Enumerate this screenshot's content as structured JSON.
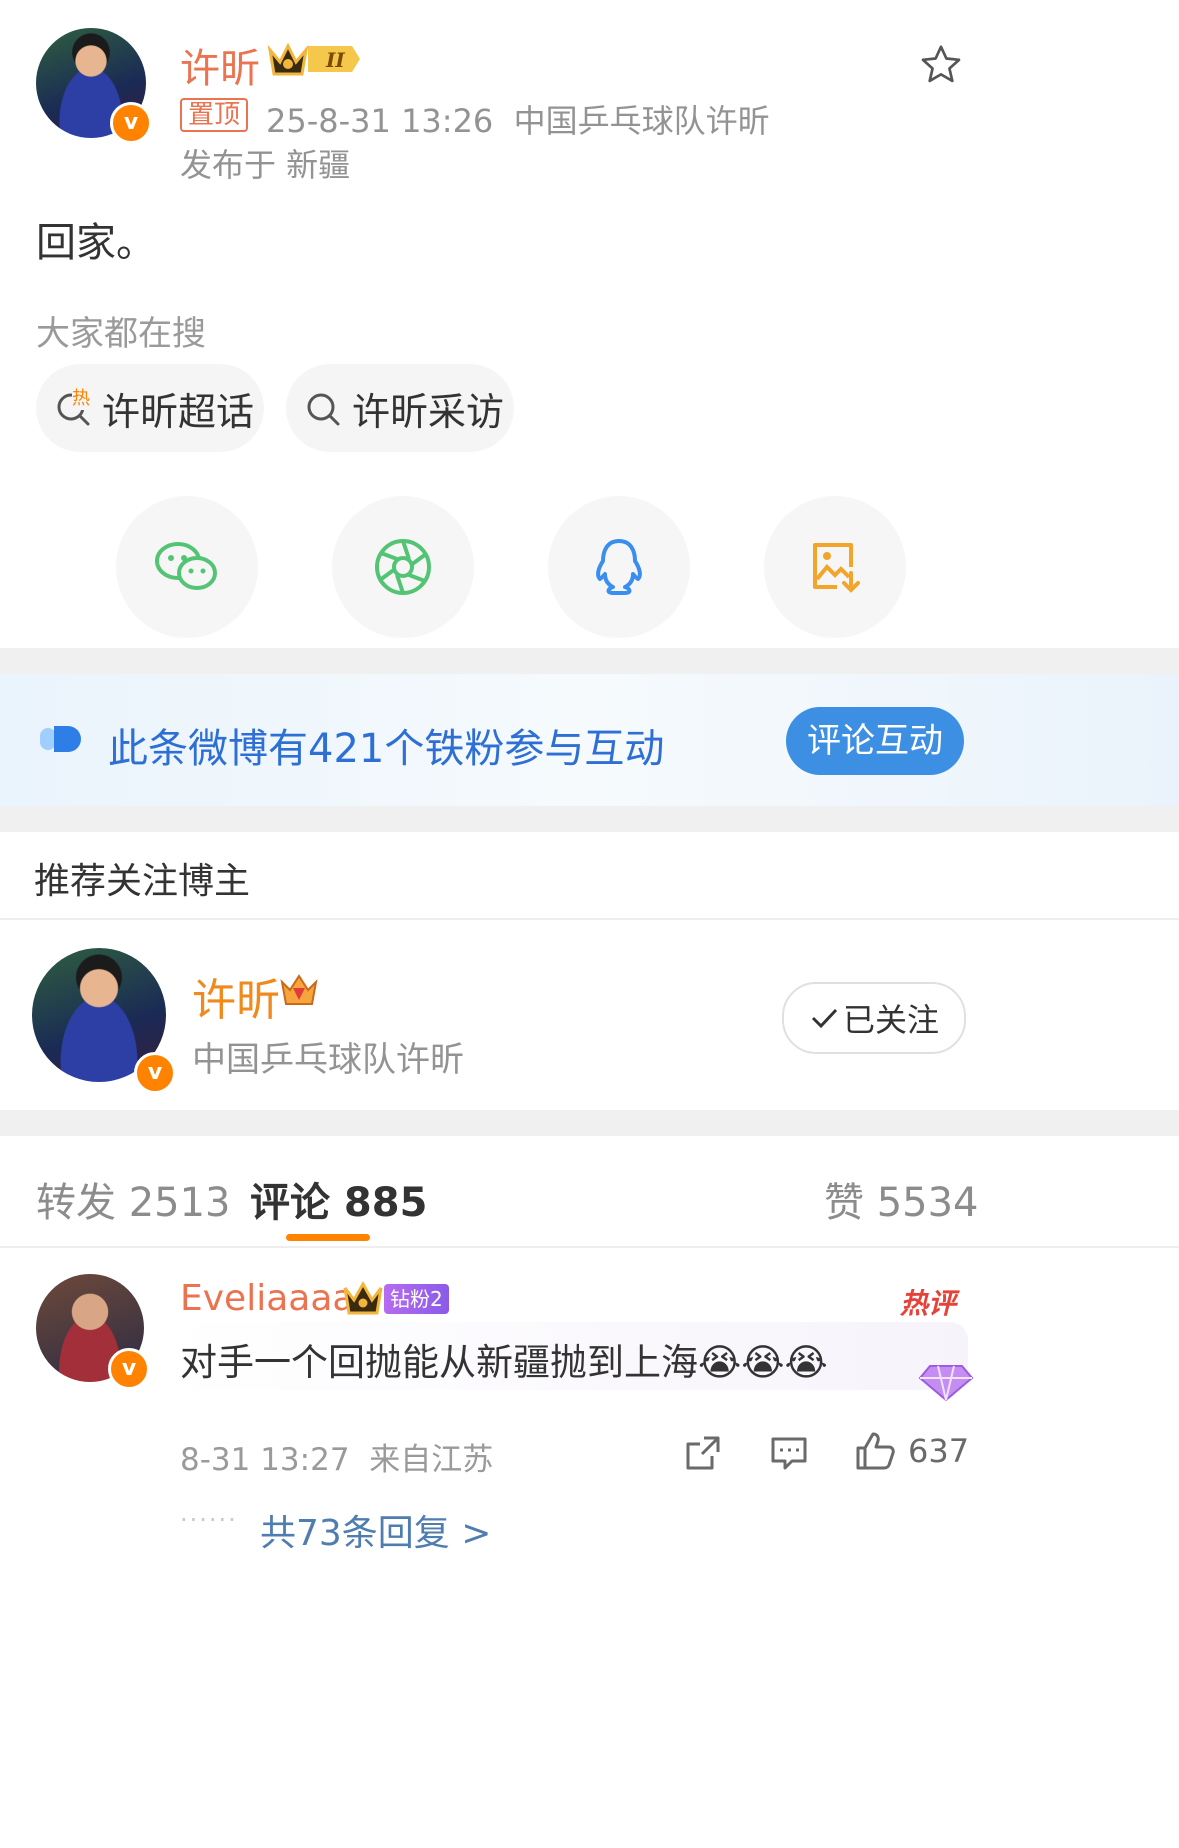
{
  "post": {
    "author": "许昕",
    "level_badge": "II",
    "pinned_label": "置顶",
    "meta": "25-8-31 13:26  中国乒乓球队许昕",
    "location": "发布于 新疆",
    "content": "回家。"
  },
  "search": {
    "title": "大家都在搜",
    "hot_tag": "热",
    "items": [
      "许昕超话",
      "许昕采访"
    ]
  },
  "share_icons": [
    "wechat-icon",
    "moments-icon",
    "qq-icon",
    "save-image-icon"
  ],
  "banner": {
    "text": "此条微博有421个铁粉参与互动",
    "button": "评论互动"
  },
  "recommend": {
    "title": "推荐关注博主",
    "name": "许昕",
    "desc": "中国乒乓球队许昕",
    "follow_label": "已关注"
  },
  "tabs": {
    "repost": "转发 2513",
    "comment": "评论 885",
    "like": "赞 5534"
  },
  "comment": {
    "user": "Eveliaaaa",
    "fan_badge": "钻粉2",
    "hot_label": "热评",
    "text": "对手一个回抛能从新疆抛到上海",
    "emoji": [
      "😭",
      "😭",
      "😭"
    ],
    "meta": "8-31 13:27  来自江苏",
    "likes": "637",
    "replies": "共73条回复 >",
    "dots": "······"
  },
  "colors": {
    "brand_orange": "#eb7350",
    "link_blue": "#507daf",
    "banner_button": "#3d8fe3",
    "tab_underline": "#ff8200"
  }
}
